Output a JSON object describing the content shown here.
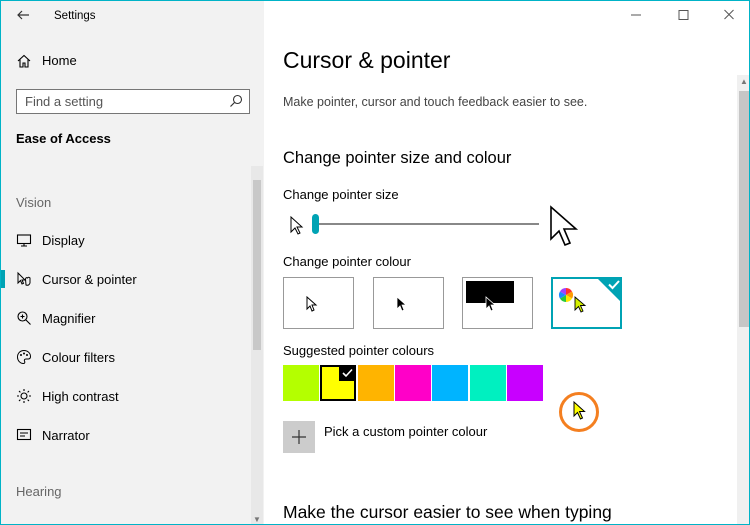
{
  "window": {
    "title": "Settings"
  },
  "sidebar": {
    "home_label": "Home",
    "search_placeholder": "Find a setting",
    "current_section": "Ease of Access",
    "groups": [
      {
        "heading": "Vision",
        "items": [
          {
            "label": "Display",
            "icon": "monitor-icon"
          },
          {
            "label": "Cursor & pointer",
            "icon": "cursor-pointer-icon",
            "active": true
          },
          {
            "label": "Magnifier",
            "icon": "magnifier-icon"
          },
          {
            "label": "Colour filters",
            "icon": "colour-filters-icon"
          },
          {
            "label": "High contrast",
            "icon": "brightness-icon"
          },
          {
            "label": "Narrator",
            "icon": "narrator-icon"
          }
        ]
      },
      {
        "heading": "Hearing",
        "items": []
      }
    ]
  },
  "main": {
    "title": "Cursor & pointer",
    "description": "Make pointer, cursor and touch feedback easier to see.",
    "section_size_colour": "Change pointer size and colour",
    "pointer_size_label": "Change pointer size",
    "pointer_size_value": 1,
    "pointer_colour_label": "Change pointer colour",
    "pointer_colour_options": [
      "white",
      "black",
      "inverted",
      "custom"
    ],
    "selected_colour_option": "custom",
    "suggested_label": "Suggested pointer colours",
    "suggested_colours": [
      "#b4ff00",
      "#ffff00",
      "#ffb400",
      "#ff00c8",
      "#00b4ff",
      "#00f0c0",
      "#c800ff"
    ],
    "selected_suggested": 1,
    "custom_colour_label": "Pick a custom pointer colour",
    "section_typing": "Make the cursor easier to see when typing"
  },
  "colors": {
    "accent": "#00a3b4",
    "annotation": "#f47f20",
    "pointer": "#ffff00"
  }
}
